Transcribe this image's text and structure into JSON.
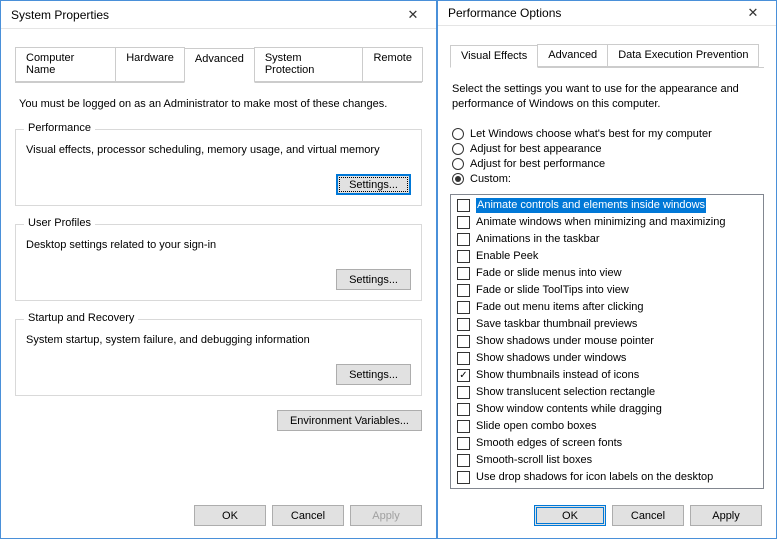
{
  "sysprops": {
    "title": "System Properties",
    "tabs": [
      "Computer Name",
      "Hardware",
      "Advanced",
      "System Protection",
      "Remote"
    ],
    "active_tab": 2,
    "intro": "You must be logged on as an Administrator to make most of these changes.",
    "groups": {
      "performance": {
        "legend": "Performance",
        "desc": "Visual effects, processor scheduling, memory usage, and virtual memory",
        "settings_btn": "Settings..."
      },
      "userprofiles": {
        "legend": "User Profiles",
        "desc": "Desktop settings related to your sign-in",
        "settings_btn": "Settings..."
      },
      "startup": {
        "legend": "Startup and Recovery",
        "desc": "System startup, system failure, and debugging information",
        "settings_btn": "Settings..."
      }
    },
    "env_btn": "Environment Variables...",
    "ok": "OK",
    "cancel": "Cancel",
    "apply": "Apply"
  },
  "perfopts": {
    "title": "Performance Options",
    "tabs": [
      "Visual Effects",
      "Advanced",
      "Data Execution Prevention"
    ],
    "active_tab": 0,
    "intro": "Select the settings you want to use for the appearance and performance of Windows on this computer.",
    "radios": [
      {
        "label": "Let Windows choose what's best for my computer",
        "checked": false
      },
      {
        "label": "Adjust for best appearance",
        "checked": false
      },
      {
        "label": "Adjust for best performance",
        "checked": false
      },
      {
        "label": "Custom:",
        "checked": true
      }
    ],
    "options": [
      {
        "label": "Animate controls and elements inside windows",
        "checked": false,
        "selected": true
      },
      {
        "label": "Animate windows when minimizing and maximizing",
        "checked": false
      },
      {
        "label": "Animations in the taskbar",
        "checked": false
      },
      {
        "label": "Enable Peek",
        "checked": false
      },
      {
        "label": "Fade or slide menus into view",
        "checked": false
      },
      {
        "label": "Fade or slide ToolTips into view",
        "checked": false
      },
      {
        "label": "Fade out menu items after clicking",
        "checked": false
      },
      {
        "label": "Save taskbar thumbnail previews",
        "checked": false
      },
      {
        "label": "Show shadows under mouse pointer",
        "checked": false
      },
      {
        "label": "Show shadows under windows",
        "checked": false
      },
      {
        "label": "Show thumbnails instead of icons",
        "checked": true
      },
      {
        "label": "Show translucent selection rectangle",
        "checked": false
      },
      {
        "label": "Show window contents while dragging",
        "checked": false
      },
      {
        "label": "Slide open combo boxes",
        "checked": false
      },
      {
        "label": "Smooth edges of screen fonts",
        "checked": false
      },
      {
        "label": "Smooth-scroll list boxes",
        "checked": false
      },
      {
        "label": "Use drop shadows for icon labels on the desktop",
        "checked": false
      }
    ],
    "ok": "OK",
    "cancel": "Cancel",
    "apply": "Apply"
  }
}
